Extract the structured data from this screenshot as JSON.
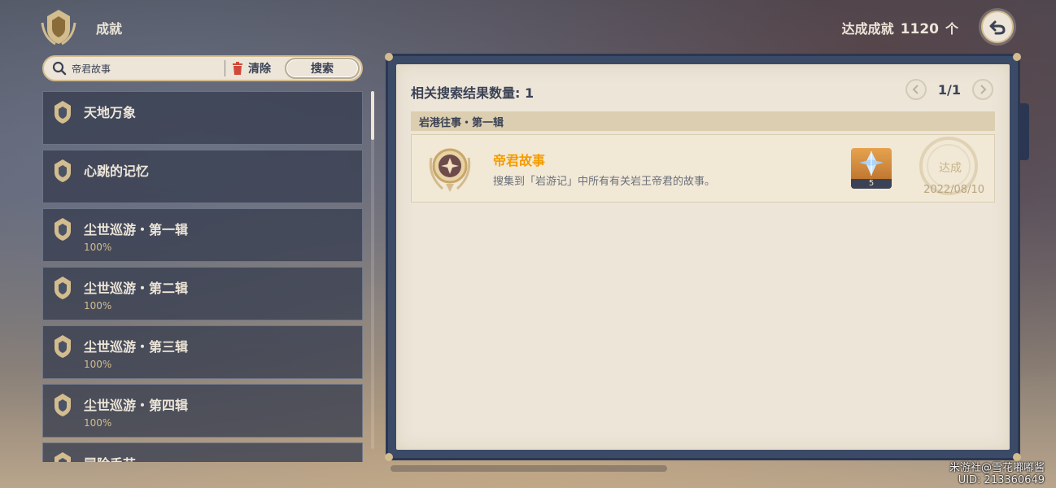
{
  "header": {
    "title": "成就",
    "achieved_label": "达成成就",
    "achieved_count": "1120",
    "achieved_unit": "个"
  },
  "search": {
    "value": "帝君故事",
    "clear_label": "清除",
    "search_label": "搜索"
  },
  "categories": [
    {
      "name": "天地万象",
      "percent": ""
    },
    {
      "name": "心跳的记忆",
      "percent": ""
    },
    {
      "name": "尘世巡游・第一辑",
      "percent": "100%"
    },
    {
      "name": "尘世巡游・第二辑",
      "percent": "100%"
    },
    {
      "name": "尘世巡游・第三辑",
      "percent": "100%"
    },
    {
      "name": "尘世巡游・第四辑",
      "percent": "100%"
    },
    {
      "name": "冒险手艺",
      "percent": ""
    }
  ],
  "results": {
    "title": "相关搜索结果数量: 1",
    "page": "1/1",
    "group": "岩港往事・第一辑",
    "achievement": {
      "name": "帝君故事",
      "description": "搜集到「岩游记」中所有有关岩王帝君的故事。",
      "reward_qty": "5",
      "status": "达成",
      "date": "2022/08/10"
    }
  },
  "watermark": {
    "line1": "米游社@雪花嘟嘟酱",
    "line2": "UID: 213360649"
  },
  "colors": {
    "accent_gold": "#d3bc8e",
    "achievement_name": "#f39c00",
    "panel_paper": "#ece5d8",
    "text_dark": "#3b4255"
  }
}
